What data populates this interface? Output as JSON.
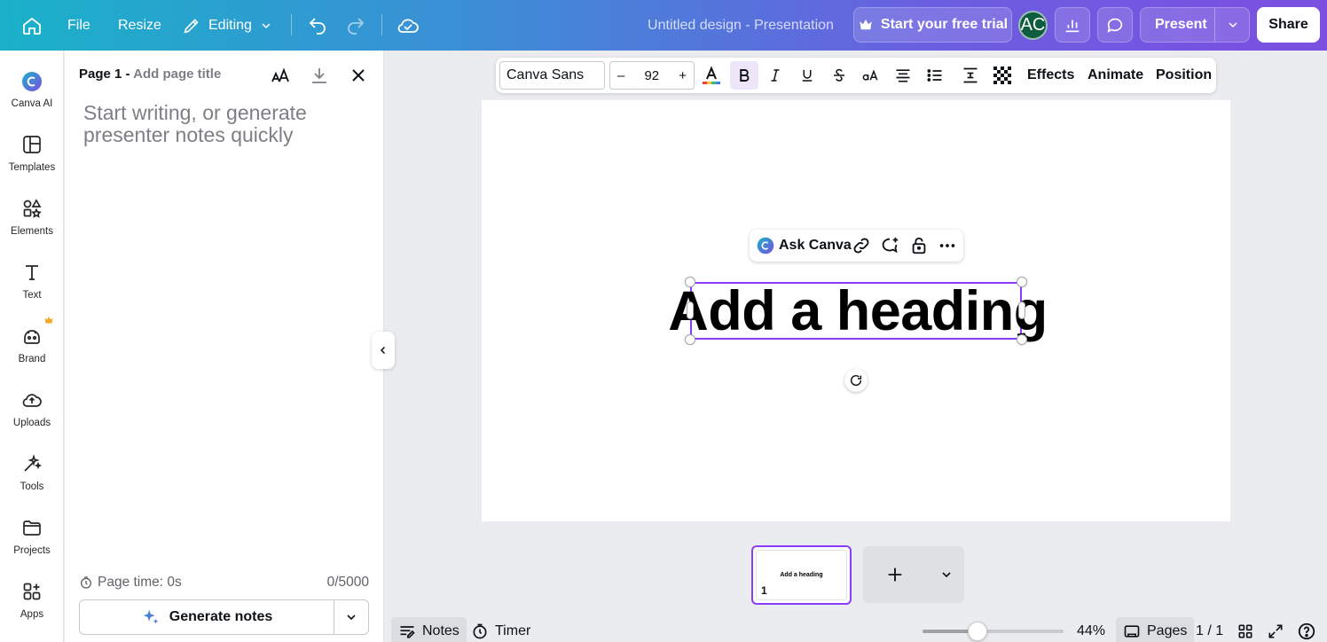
{
  "topbar": {
    "file": "File",
    "resize": "Resize",
    "editing": "Editing",
    "doc_title": "Untitled design - Presentation",
    "trial": "Start your free trial",
    "avatar": "AC",
    "present": "Present",
    "share": "Share"
  },
  "rail": {
    "items": [
      {
        "label": "Canva AI"
      },
      {
        "label": "Templates"
      },
      {
        "label": "Elements"
      },
      {
        "label": "Text"
      },
      {
        "label": "Brand"
      },
      {
        "label": "Uploads"
      },
      {
        "label": "Tools"
      },
      {
        "label": "Projects"
      },
      {
        "label": "Apps"
      }
    ]
  },
  "notes": {
    "page_label": "Page 1 - ",
    "page_title_placeholder": "Add page title",
    "placeholder": "Start writing, or generate presenter notes quickly",
    "page_time": "Page time: 0s",
    "char_count": "0/5000",
    "generate": "Generate notes"
  },
  "text_toolbar": {
    "font": "Canva Sans",
    "size": "92",
    "minus": "–",
    "plus": "+",
    "effects": "Effects",
    "animate": "Animate",
    "position": "Position"
  },
  "canvas": {
    "ask_canva": "Ask Canva",
    "heading": "Add a heading"
  },
  "pages": {
    "thumb_heading": "Add a heading",
    "thumb_number": "1"
  },
  "bottombar": {
    "notes": "Notes",
    "timer": "Timer",
    "zoom": "44%",
    "pages": "Pages",
    "page_count": "1 / 1"
  },
  "colors": {
    "accent": "#8b3dff",
    "topbar_start": "#1ab1c9",
    "topbar_end": "#7b4fe0"
  }
}
